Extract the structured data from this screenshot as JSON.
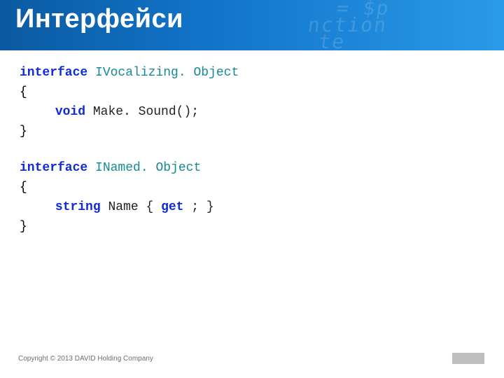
{
  "header": {
    "title": "Интерфейси"
  },
  "code": {
    "block1": {
      "l1_kw": "interface",
      "l1_typ": "IVocalizing. Object",
      "l2": "{",
      "l3_kw": "void",
      "l3_id": "Make. Sound();",
      "l4": "}"
    },
    "block2": {
      "l1_kw": "interface",
      "l1_typ": "INamed. Object",
      "l2": "{",
      "l3_kw1": "string",
      "l3_name": "Name {",
      "l3_kw2": "get",
      "l3_tail": "; }",
      "l4": "}"
    }
  },
  "footer": {
    "copyright": "Copyright © 2013 DAVID Holding Company"
  }
}
